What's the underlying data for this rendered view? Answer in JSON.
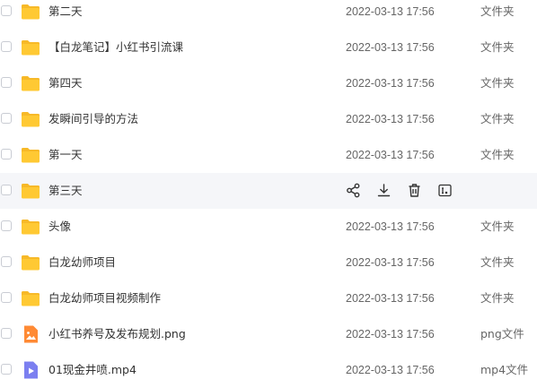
{
  "files": [
    {
      "name": "第二天",
      "time": "2022-03-13 17:56",
      "type": "文件夹",
      "icon": "folder-icon",
      "hovered": false
    },
    {
      "name": "【白龙笔记】小红书引流课",
      "time": "2022-03-13 17:56",
      "type": "文件夹",
      "icon": "folder-icon",
      "hovered": false
    },
    {
      "name": "第四天",
      "time": "2022-03-13 17:56",
      "type": "文件夹",
      "icon": "folder-icon",
      "hovered": false
    },
    {
      "name": "发瞬间引导的方法",
      "time": "2022-03-13 17:56",
      "type": "文件夹",
      "icon": "folder-icon",
      "hovered": false
    },
    {
      "name": "第一天",
      "time": "2022-03-13 17:56",
      "type": "文件夹",
      "icon": "folder-icon",
      "hovered": false
    },
    {
      "name": "第三天",
      "time": "",
      "type": "",
      "icon": "folder-icon",
      "hovered": true
    },
    {
      "name": "头像",
      "time": "2022-03-13 17:56",
      "type": "文件夹",
      "icon": "folder-icon",
      "hovered": false
    },
    {
      "name": "白龙幼师项目",
      "time": "2022-03-13 17:56",
      "type": "文件夹",
      "icon": "folder-icon",
      "hovered": false
    },
    {
      "name": "白龙幼师项目视频制作",
      "time": "2022-03-13 17:56",
      "type": "文件夹",
      "icon": "folder-icon",
      "hovered": false
    },
    {
      "name": "小红书养号及发布规划.png",
      "time": "2022-03-13 17:56",
      "type": "png文件",
      "icon": "image-file-icon",
      "hovered": false
    },
    {
      "name": "01现金井喷.mp4",
      "time": "2022-03-13 17:56",
      "type": "mp4文件",
      "icon": "video-file-icon",
      "hovered": false
    }
  ],
  "hover_actions": [
    "share-icon",
    "download-icon",
    "delete-icon",
    "rename-icon"
  ],
  "colors": {
    "folder": "#ffc933",
    "folder_back": "#f7b928",
    "image_file": "#ff8a34",
    "video_file": "#7b7ff0",
    "action_icon": "#333333",
    "hover_row": "#f5f6f9"
  }
}
